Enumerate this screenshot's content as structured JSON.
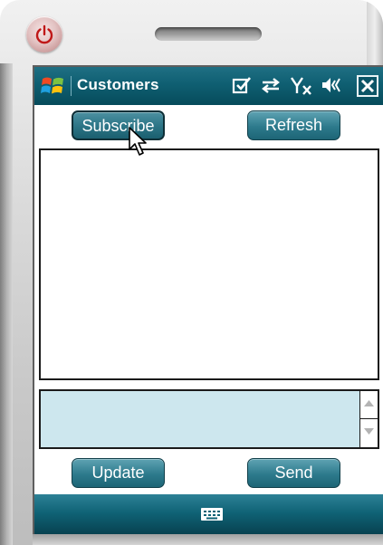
{
  "window": {
    "title": "Customers"
  },
  "buttons": {
    "subscribe": "Subscribe",
    "refresh": "Refresh",
    "update": "Update",
    "send": "Send"
  },
  "status_icons": [
    "checkbox-icon",
    "sync-arrows-icon",
    "no-signal-antenna-icon",
    "speaker-icon"
  ],
  "icons": {
    "start": "windows-flag-icon",
    "close": "close-icon",
    "keyboard": "keyboard-icon",
    "power": "power-icon"
  },
  "list": {
    "items": []
  },
  "message_box": {
    "value": ""
  },
  "colors": {
    "titlebar": "#0f5f72",
    "button": "#2d7a8c",
    "textarea_bg": "#cde7ee",
    "menubar": "#0f6275"
  }
}
